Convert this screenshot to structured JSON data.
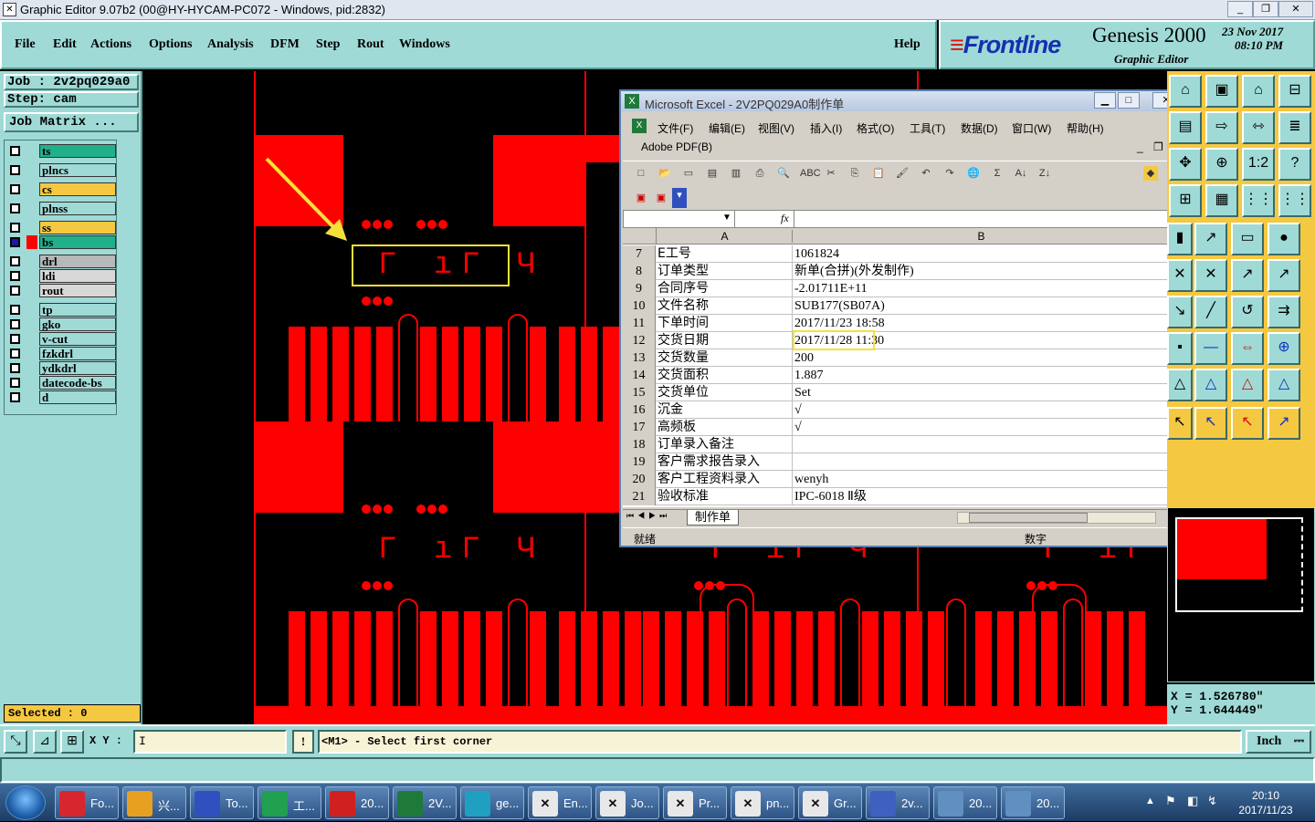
{
  "window": {
    "title": "Graphic Editor 9.07b2 (00@HY-HYCAM-PC072 - Windows, pid:2832)",
    "controls": [
      "_",
      "❐",
      "✕"
    ]
  },
  "menubar": {
    "items": [
      "File",
      "Edit",
      "Actions",
      "Options",
      "Analysis",
      "DFM",
      "Step",
      "Rout",
      "Windows"
    ],
    "help": "Help"
  },
  "brand": {
    "logo": "Frontline",
    "product": "Genesis 2000",
    "subtitle": "Graphic Editor",
    "date": "23 Nov 2017",
    "time": "08:10 PM"
  },
  "leftpanel": {
    "job": "Job : 2v2pq029a0",
    "step": "Step: cam",
    "job_matrix": "Job Matrix ...",
    "layers": [
      {
        "name": "ts",
        "color": "#20b08a",
        "selected": false
      },
      {
        "name": "plncs",
        "color": "#9fdad6",
        "selected": false
      },
      {
        "name": "cs",
        "color": "#f5c842",
        "selected": false
      },
      {
        "name": "plnss",
        "color": "#9fdad6",
        "selected": false
      },
      {
        "name": "ss",
        "color": "#f5c842",
        "selected": false
      },
      {
        "name": "bs",
        "color": "#20b08a",
        "selected": true
      },
      {
        "name": "drl",
        "color": "#b8b8b8",
        "selected": false
      },
      {
        "name": "ldi",
        "color": "#d8d8d8",
        "selected": false
      },
      {
        "name": "rout",
        "color": "#d8d8d8",
        "selected": false
      },
      {
        "name": "tp",
        "color": "#9fdad6",
        "selected": false
      },
      {
        "name": "gko",
        "color": "#9fdad6",
        "selected": false
      },
      {
        "name": "v-cut",
        "color": "#9fdad6",
        "selected": false
      },
      {
        "name": "fzkdrl",
        "color": "#9fdad6",
        "selected": false
      },
      {
        "name": "ydkdrl",
        "color": "#9fdad6",
        "selected": false
      },
      {
        "name": "datecode-bs",
        "color": "#9fdad6",
        "selected": false
      },
      {
        "name": "d",
        "color": "#9fdad6",
        "selected": false
      }
    ],
    "selected": "Selected : 0"
  },
  "coords": {
    "x": "X  =  1.526780\"",
    "y": "Y  =  1.644449\""
  },
  "bottombar": {
    "xy_label": "X Y :",
    "xy_value": "I",
    "bang": "!",
    "prompt": "<M1> - Select first corner",
    "unit": "Inch"
  },
  "excel": {
    "title": "Microsoft Excel - 2V2PQ029A0制作单",
    "menu": [
      "文件(F)",
      "编辑(E)",
      "视图(V)",
      "插入(I)",
      "格式(O)",
      "工具(T)",
      "数据(D)",
      "窗口(W)",
      "帮助(H)"
    ],
    "adobe": "Adobe PDF(B)",
    "fx": "fx",
    "col_a": "A",
    "col_b": "B",
    "rows": [
      {
        "n": "7",
        "a": "E工号",
        "b": "1061824"
      },
      {
        "n": "8",
        "a": "订单类型",
        "b": "新单(合拼)(外发制作)"
      },
      {
        "n": "9",
        "a": "合同序号",
        "b": "-2.01711E+11"
      },
      {
        "n": "10",
        "a": "文件名称",
        "b": "SUB177(SB07A)"
      },
      {
        "n": "11",
        "a": "下单时间",
        "b": "2017/11/23 18:58"
      },
      {
        "n": "12",
        "a": "交货日期",
        "b": "2017/11/28 11:30"
      },
      {
        "n": "13",
        "a": "交货数量",
        "b": "200"
      },
      {
        "n": "14",
        "a": "交货面积",
        "b": "1.887"
      },
      {
        "n": "15",
        "a": "交货单位",
        "b": "Set"
      },
      {
        "n": "16",
        "a": "沉金",
        "b": "√"
      },
      {
        "n": "17",
        "a": "高频板",
        "b": "√"
      },
      {
        "n": "18",
        "a": "订单录入备注",
        "b": ""
      },
      {
        "n": "19",
        "a": "客户需求报告录入",
        "b": ""
      },
      {
        "n": "20",
        "a": "客户工程资料录入",
        "b": "wenyh"
      },
      {
        "n": "21",
        "a": "验收标准",
        "b": "IPC-6018 Ⅱ级"
      }
    ],
    "sheet_tab": "制作单",
    "status_ready": "就绪",
    "status_num": "数字"
  },
  "taskbar": {
    "items": [
      {
        "label": "Fo...",
        "icon": "foxit-icon",
        "color": "#d8262e"
      },
      {
        "label": "兴...",
        "icon": "shell-icon",
        "color": "#e8a020"
      },
      {
        "label": "To...",
        "icon": "floppy-icon",
        "color": "#3050c0"
      },
      {
        "label": "工...",
        "icon": "p-icon",
        "color": "#20a050"
      },
      {
        "label": "20...",
        "icon": "pdf-icon",
        "color": "#d02020"
      },
      {
        "label": "2V...",
        "icon": "excel-icon",
        "color": "#1f7a3a"
      },
      {
        "label": "ge...",
        "icon": "eye-icon",
        "color": "#20a0c0"
      },
      {
        "label": "En...",
        "icon": "genesis-icon",
        "color": "#e8e8e8"
      },
      {
        "label": "Jo...",
        "icon": "genesis-icon",
        "color": "#e8e8e8"
      },
      {
        "label": "Pr...",
        "icon": "genesis-icon",
        "color": "#e8e8e8"
      },
      {
        "label": "pn...",
        "icon": "genesis-icon",
        "color": "#e8e8e8"
      },
      {
        "label": "Gr...",
        "icon": "genesis-icon",
        "color": "#e8e8e8"
      },
      {
        "label": "2v...",
        "icon": "editor-icon",
        "color": "#4060c0"
      },
      {
        "label": "20...",
        "icon": "image-icon",
        "color": "#6090c0"
      },
      {
        "label": "20...",
        "icon": "image-icon",
        "color": "#6090c0"
      }
    ],
    "clock_time": "20:10",
    "clock_date": "2017/11/23"
  }
}
